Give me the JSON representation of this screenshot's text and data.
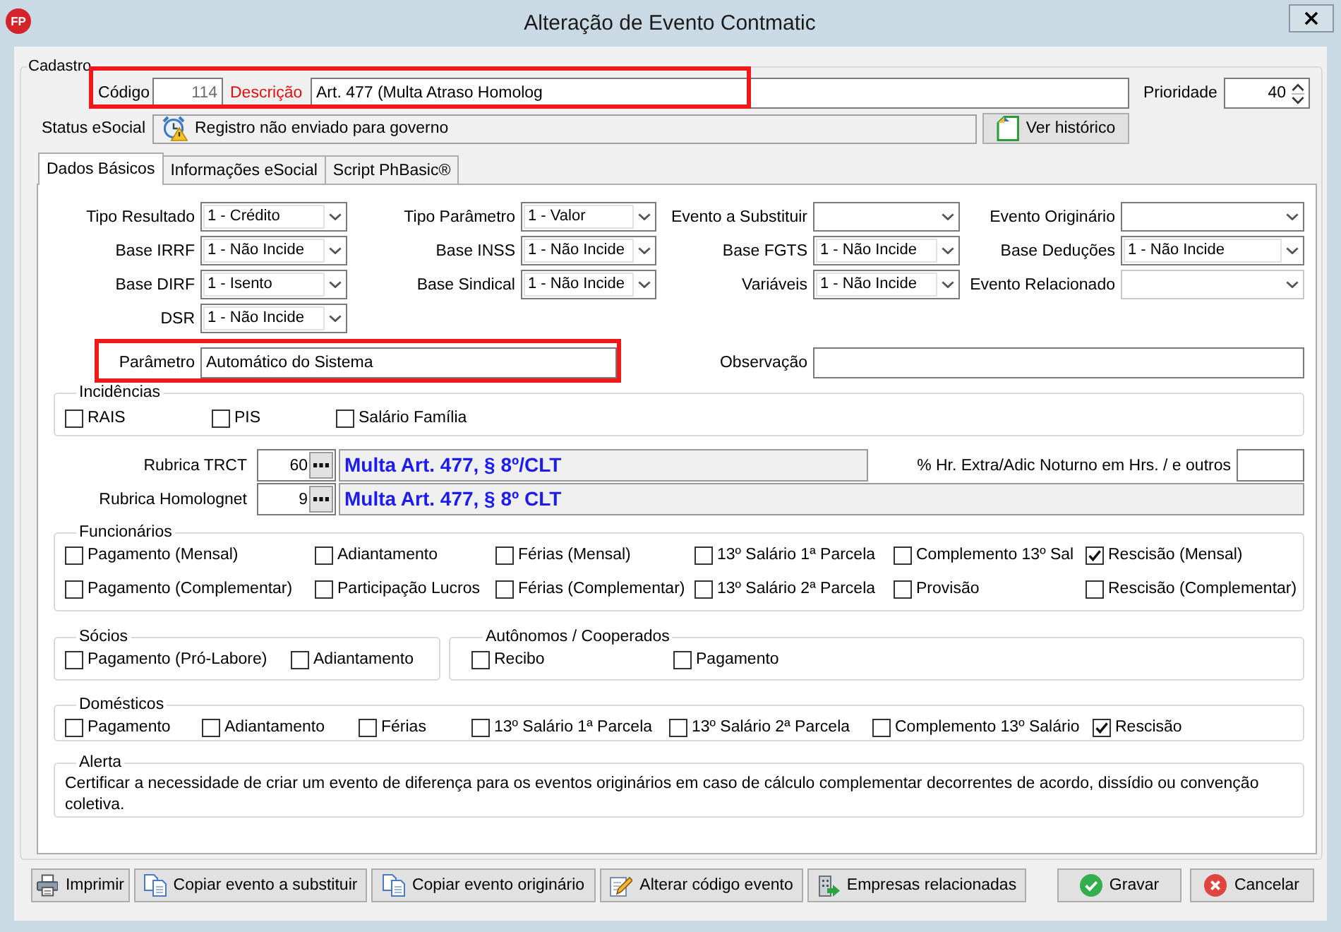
{
  "window": {
    "logo": "FP",
    "title": "Alteração de Evento Contmatic"
  },
  "cadastro": {
    "title": "Cadastro",
    "highlighted": true,
    "code": {
      "label": "Código",
      "value": "114",
      "required": false,
      "read_only": true
    },
    "description": {
      "label": "Descrição",
      "value": "Art. 477 (Multa Atraso Homolog",
      "required": true,
      "read_only": false
    },
    "priority": {
      "label": "Prioridade",
      "value": "40"
    },
    "status": {
      "label": "Status eSocial",
      "value": "Registro não enviado para governo"
    },
    "history_button": {
      "label": "Ver histórico"
    }
  },
  "tabs": [
    {
      "label": "Dados Básicos",
      "selected": true
    },
    {
      "label": "Informações eSocial",
      "selected": false
    },
    {
      "label": "Script PhBasic®",
      "selected": false
    }
  ],
  "combo_columns": [
    [
      {
        "label": "Tipo Resultado",
        "value": "1 - Crédito",
        "disabled": false
      },
      {
        "label": "Base IRRF",
        "value": "1 - Não Incide",
        "disabled": false
      },
      {
        "label": "Base DIRF",
        "value": "1 - Isento",
        "disabled": false
      },
      {
        "label": "DSR",
        "value": "1 - Não Incide",
        "disabled": false
      }
    ],
    [
      {
        "label": "Tipo Parâmetro",
        "value": "1 - Valor",
        "disabled": false
      },
      {
        "label": "Base INSS",
        "value": "1 - Não Incide",
        "disabled": false
      },
      {
        "label": "Base Sindical",
        "value": "1 - Não Incide",
        "disabled": false
      }
    ],
    [
      {
        "label": "Evento a Substituir",
        "disabled": false
      },
      {
        "label": "Base FGTS",
        "value": "1 - Não Incide",
        "disabled": false
      },
      {
        "label": "Variáveis",
        "value": "1 - Não Incide",
        "disabled": false
      }
    ],
    [
      {
        "label": "Evento Originário",
        "disabled": false
      },
      {
        "label": "Base Deduções",
        "value": "1 - Não Incide",
        "disabled": false
      },
      {
        "label": "Evento Relacionado",
        "disabled": true
      }
    ]
  ],
  "parameter": {
    "label": "Parâmetro",
    "value": "Automático do Sistema",
    "highlighted": true
  },
  "observation": {
    "label": "Observação"
  },
  "incidencias": {
    "title": "Incidências",
    "items": [
      {
        "label": "RAIS",
        "checked": false
      },
      {
        "label": "PIS",
        "checked": false
      },
      {
        "label": "Salário Família",
        "checked": false
      }
    ]
  },
  "rubricas": [
    {
      "label": "Rubrica TRCT",
      "code": "60",
      "description": "Multa Art. 477, § 8º/CLT"
    },
    {
      "label": "Rubrica Homolognet",
      "code": "9",
      "description": "Multa Art. 477, § 8º CLT"
    }
  ],
  "extra_hours": {
    "label": "% Hr. Extra/Adic Noturno em Hrs. / e outros"
  },
  "funcionarios": {
    "title": "Funcionários",
    "items": [
      {
        "label": "Pagamento (Mensal)",
        "checked": false
      },
      {
        "label": "Adiantamento",
        "checked": false
      },
      {
        "label": "Férias (Mensal)",
        "checked": false
      },
      {
        "label": "13º Salário 1ª Parcela",
        "checked": false
      },
      {
        "label": "Complemento 13º Sal",
        "checked": false
      },
      {
        "label": "Rescisão (Mensal)",
        "checked": true
      },
      {
        "label": "Pagamento (Complementar)",
        "checked": false
      },
      {
        "label": "Participação Lucros",
        "checked": false
      },
      {
        "label": "Férias (Complementar)",
        "checked": false
      },
      {
        "label": "13º Salário 2ª Parcela",
        "checked": false
      },
      {
        "label": "Provisão",
        "checked": false
      },
      {
        "label": "Rescisão (Complementar)",
        "checked": false
      }
    ]
  },
  "socios": {
    "title": "Sócios",
    "items": [
      {
        "label": "Pagamento (Pró-Labore)",
        "checked": false
      },
      {
        "label": "Adiantamento",
        "checked": false
      }
    ]
  },
  "autonomos": {
    "title": "Autônomos / Cooperados",
    "items": [
      {
        "label": "Recibo",
        "checked": false
      },
      {
        "label": "Pagamento",
        "checked": false
      }
    ]
  },
  "domesticos": {
    "title": "Domésticos",
    "items": [
      {
        "label": "Pagamento",
        "checked": false
      },
      {
        "label": "Adiantamento",
        "checked": false
      },
      {
        "label": "Férias",
        "checked": false
      },
      {
        "label": "13º Salário 1ª Parcela",
        "checked": false
      },
      {
        "label": "13º Salário 2ª Parcela",
        "checked": false
      },
      {
        "label": "Complemento 13º Salário",
        "checked": false
      },
      {
        "label": "Rescisão",
        "checked": true
      }
    ]
  },
  "alert": {
    "title": "Alerta",
    "text": "Certificar a necessidade de criar um evento de diferença para os eventos originários em caso de cálculo complementar decorrentes de acordo, dissídio ou convenção coletiva."
  },
  "actions": [
    {
      "label": "Imprimir",
      "kind": "print"
    },
    {
      "label": "Copiar evento a substituir",
      "kind": "copy"
    },
    {
      "label": "Copiar evento originário",
      "kind": "copy"
    },
    {
      "label": "Alterar código evento",
      "kind": "edit"
    },
    {
      "label": "Empresas relacionadas",
      "kind": "companies"
    }
  ],
  "dialog_buttons": [
    {
      "label": "Gravar",
      "kind": "save"
    },
    {
      "label": "Cancelar",
      "kind": "cancel"
    }
  ]
}
